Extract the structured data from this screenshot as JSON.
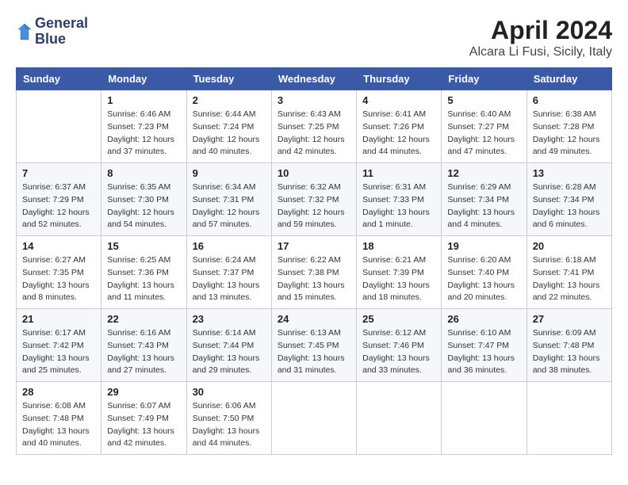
{
  "header": {
    "logo_line1": "General",
    "logo_line2": "Blue",
    "month": "April 2024",
    "location": "Alcara Li Fusi, Sicily, Italy"
  },
  "weekdays": [
    "Sunday",
    "Monday",
    "Tuesday",
    "Wednesday",
    "Thursday",
    "Friday",
    "Saturday"
  ],
  "weeks": [
    [
      {
        "day": "",
        "info": ""
      },
      {
        "day": "1",
        "info": "Sunrise: 6:46 AM\nSunset: 7:23 PM\nDaylight: 12 hours\nand 37 minutes."
      },
      {
        "day": "2",
        "info": "Sunrise: 6:44 AM\nSunset: 7:24 PM\nDaylight: 12 hours\nand 40 minutes."
      },
      {
        "day": "3",
        "info": "Sunrise: 6:43 AM\nSunset: 7:25 PM\nDaylight: 12 hours\nand 42 minutes."
      },
      {
        "day": "4",
        "info": "Sunrise: 6:41 AM\nSunset: 7:26 PM\nDaylight: 12 hours\nand 44 minutes."
      },
      {
        "day": "5",
        "info": "Sunrise: 6:40 AM\nSunset: 7:27 PM\nDaylight: 12 hours\nand 47 minutes."
      },
      {
        "day": "6",
        "info": "Sunrise: 6:38 AM\nSunset: 7:28 PM\nDaylight: 12 hours\nand 49 minutes."
      }
    ],
    [
      {
        "day": "7",
        "info": "Sunrise: 6:37 AM\nSunset: 7:29 PM\nDaylight: 12 hours\nand 52 minutes."
      },
      {
        "day": "8",
        "info": "Sunrise: 6:35 AM\nSunset: 7:30 PM\nDaylight: 12 hours\nand 54 minutes."
      },
      {
        "day": "9",
        "info": "Sunrise: 6:34 AM\nSunset: 7:31 PM\nDaylight: 12 hours\nand 57 minutes."
      },
      {
        "day": "10",
        "info": "Sunrise: 6:32 AM\nSunset: 7:32 PM\nDaylight: 12 hours\nand 59 minutes."
      },
      {
        "day": "11",
        "info": "Sunrise: 6:31 AM\nSunset: 7:33 PM\nDaylight: 13 hours\nand 1 minute."
      },
      {
        "day": "12",
        "info": "Sunrise: 6:29 AM\nSunset: 7:34 PM\nDaylight: 13 hours\nand 4 minutes."
      },
      {
        "day": "13",
        "info": "Sunrise: 6:28 AM\nSunset: 7:34 PM\nDaylight: 13 hours\nand 6 minutes."
      }
    ],
    [
      {
        "day": "14",
        "info": "Sunrise: 6:27 AM\nSunset: 7:35 PM\nDaylight: 13 hours\nand 8 minutes."
      },
      {
        "day": "15",
        "info": "Sunrise: 6:25 AM\nSunset: 7:36 PM\nDaylight: 13 hours\nand 11 minutes."
      },
      {
        "day": "16",
        "info": "Sunrise: 6:24 AM\nSunset: 7:37 PM\nDaylight: 13 hours\nand 13 minutes."
      },
      {
        "day": "17",
        "info": "Sunrise: 6:22 AM\nSunset: 7:38 PM\nDaylight: 13 hours\nand 15 minutes."
      },
      {
        "day": "18",
        "info": "Sunrise: 6:21 AM\nSunset: 7:39 PM\nDaylight: 13 hours\nand 18 minutes."
      },
      {
        "day": "19",
        "info": "Sunrise: 6:20 AM\nSunset: 7:40 PM\nDaylight: 13 hours\nand 20 minutes."
      },
      {
        "day": "20",
        "info": "Sunrise: 6:18 AM\nSunset: 7:41 PM\nDaylight: 13 hours\nand 22 minutes."
      }
    ],
    [
      {
        "day": "21",
        "info": "Sunrise: 6:17 AM\nSunset: 7:42 PM\nDaylight: 13 hours\nand 25 minutes."
      },
      {
        "day": "22",
        "info": "Sunrise: 6:16 AM\nSunset: 7:43 PM\nDaylight: 13 hours\nand 27 minutes."
      },
      {
        "day": "23",
        "info": "Sunrise: 6:14 AM\nSunset: 7:44 PM\nDaylight: 13 hours\nand 29 minutes."
      },
      {
        "day": "24",
        "info": "Sunrise: 6:13 AM\nSunset: 7:45 PM\nDaylight: 13 hours\nand 31 minutes."
      },
      {
        "day": "25",
        "info": "Sunrise: 6:12 AM\nSunset: 7:46 PM\nDaylight: 13 hours\nand 33 minutes."
      },
      {
        "day": "26",
        "info": "Sunrise: 6:10 AM\nSunset: 7:47 PM\nDaylight: 13 hours\nand 36 minutes."
      },
      {
        "day": "27",
        "info": "Sunrise: 6:09 AM\nSunset: 7:48 PM\nDaylight: 13 hours\nand 38 minutes."
      }
    ],
    [
      {
        "day": "28",
        "info": "Sunrise: 6:08 AM\nSunset: 7:48 PM\nDaylight: 13 hours\nand 40 minutes."
      },
      {
        "day": "29",
        "info": "Sunrise: 6:07 AM\nSunset: 7:49 PM\nDaylight: 13 hours\nand 42 minutes."
      },
      {
        "day": "30",
        "info": "Sunrise: 6:06 AM\nSunset: 7:50 PM\nDaylight: 13 hours\nand 44 minutes."
      },
      {
        "day": "",
        "info": ""
      },
      {
        "day": "",
        "info": ""
      },
      {
        "day": "",
        "info": ""
      },
      {
        "day": "",
        "info": ""
      }
    ]
  ]
}
